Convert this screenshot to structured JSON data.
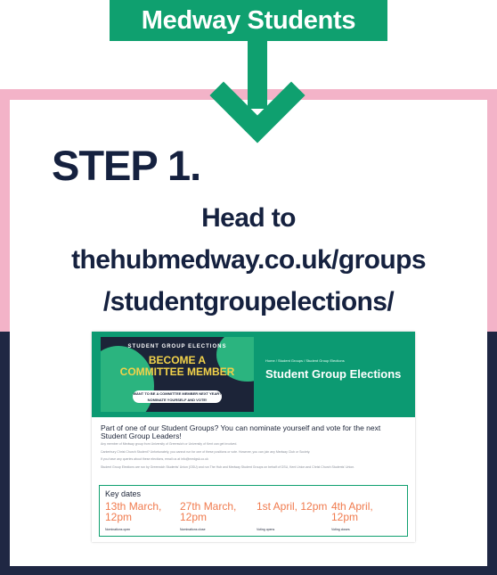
{
  "banner": {
    "title": "Medway Students"
  },
  "colors": {
    "green": "#0fa06f",
    "pink": "#f3b3c8",
    "navy": "#1f2743",
    "accent_orange": "#f07a4d"
  },
  "icons": {
    "arrow": "arrow-down-icon"
  },
  "step": {
    "heading": "STEP 1.",
    "line1": "Head to",
    "line2": "thehubmedway.co.uk/groups",
    "line3": "/studentgroupelections/"
  },
  "screenshot": {
    "hero_kicker": "STUDENT GROUP ELECTIONS",
    "hero_big": "BECOME A\nCOMMITTEE MEMBER",
    "hero_pill": "WANT TO BE A COMMITTEE MEMBER NEXT YEAR? NOMINATE YOURSELF AND VOTE!",
    "breadcrumb": "Home / Student Groups / Student Group Elections",
    "page_title": "Student Group Elections",
    "intro": "Part of one of our Student Groups? You can nominate yourself and vote for the next Student Group Leaders!",
    "small1": "Any member of Medway group from University of Greenwich or University of Kent can get involved.",
    "small2": "Canterbury Christ Church Student? Unfortunately, you cannot run for one of these positions or vote. However, you can join any Medway Club or Society.",
    "small3": "If you have any queries about these elections, email us at info@medgsk.co.uk",
    "small4": "Student Group Elections are run by Greenwich Students' Union (GSU) and run The Hub and Medway Student Groups on behalf of GSU, Kent Union and Christ Church Students' Union.",
    "key_title": "Key dates",
    "dates": [
      {
        "date": "13th March, 12pm",
        "caption": "Nominations open"
      },
      {
        "date": "27th March, 12pm",
        "caption": "Nominations close"
      },
      {
        "date": "1st April, 12pm",
        "caption": "Voting opens"
      },
      {
        "date": "4th April, 12pm",
        "caption": "Voting closes"
      }
    ]
  }
}
